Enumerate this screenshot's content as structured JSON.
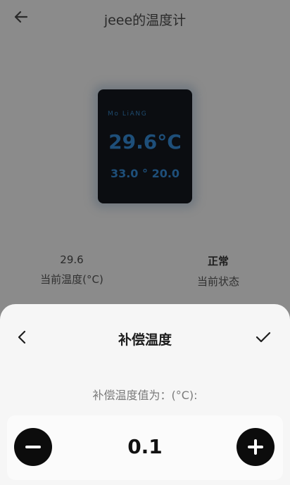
{
  "header": {
    "title": "jeee的温度计"
  },
  "device_display": {
    "brand": "Mo LiANG",
    "temperature": "29.6°C",
    "range": "33.0 ° 20.0"
  },
  "stats": {
    "current_temp_value": "29.6",
    "current_temp_label": "当前温度(°C)",
    "status_value": "正常",
    "status_label": "当前状态"
  },
  "sheet": {
    "title": "补偿温度",
    "subtitle": "补偿温度值为：(°C):",
    "value": "0.1"
  },
  "colors": {
    "accent_blue": "#1e4f7a",
    "sheet_bg": "#f6f6f6",
    "overlay_bg": "#8b8b8b"
  },
  "icons": {
    "header_back": "arrow-left-icon",
    "sheet_back": "chevron-left-icon",
    "sheet_confirm": "check-icon",
    "decrement": "minus-icon",
    "increment": "plus-icon"
  }
}
